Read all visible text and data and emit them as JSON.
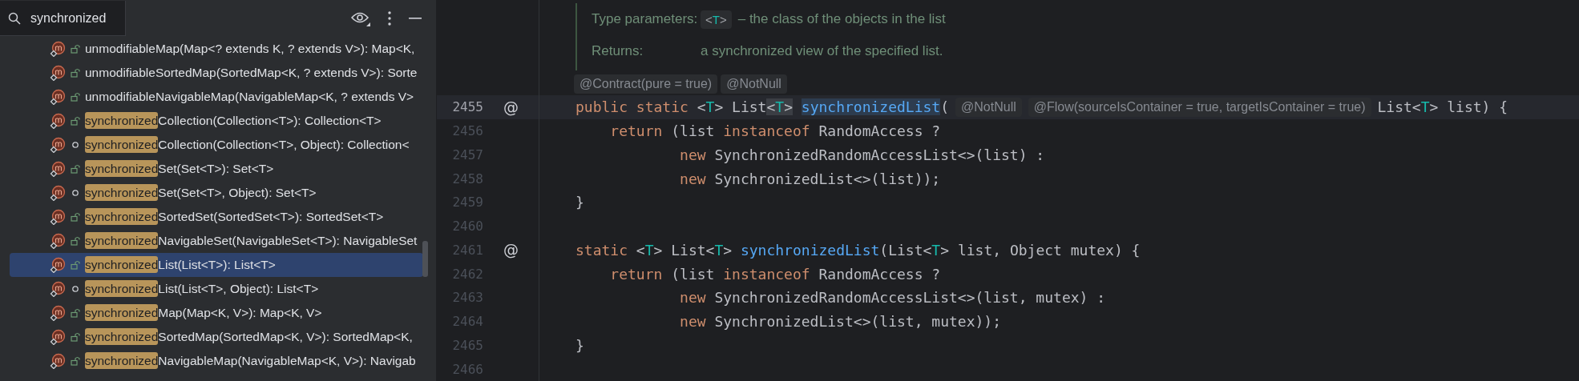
{
  "search": {
    "value": "synchronized"
  },
  "structure_items": [
    {
      "text": "unmodifiableMap(Map<? extends K, ? extends V>): Map<K,",
      "kind": "public",
      "selected": false
    },
    {
      "text": "unmodifiableSortedMap(SortedMap<K, ? extends V>): Sorte",
      "kind": "public",
      "selected": false
    },
    {
      "text": "unmodifiableNavigableMap(NavigableMap<K, ? extends V>",
      "kind": "public",
      "selected": false
    },
    {
      "match": "synchronized",
      "text": "Collection(Collection<T>): Collection<T>",
      "kind": "public",
      "selected": false
    },
    {
      "match": "synchronized",
      "text": "Collection(Collection<T>, Object): Collection<",
      "kind": "package",
      "selected": false
    },
    {
      "match": "synchronized",
      "text": "Set(Set<T>): Set<T>",
      "kind": "public",
      "selected": false
    },
    {
      "match": "synchronized",
      "text": "Set(Set<T>, Object): Set<T>",
      "kind": "package",
      "selected": false
    },
    {
      "match": "synchronized",
      "text": "SortedSet(SortedSet<T>): SortedSet<T>",
      "kind": "public",
      "selected": false
    },
    {
      "match": "synchronized",
      "text": "NavigableSet(NavigableSet<T>): NavigableSet",
      "kind": "public",
      "selected": false
    },
    {
      "match": "synchronized",
      "text": "List(List<T>): List<T>",
      "kind": "public",
      "selected": true
    },
    {
      "match": "synchronized",
      "text": "List(List<T>, Object): List<T>",
      "kind": "package",
      "selected": false
    },
    {
      "match": "synchronized",
      "text": "Map(Map<K, V>): Map<K, V>",
      "kind": "public",
      "selected": false
    },
    {
      "match": "synchronized",
      "text": "SortedMap(SortedMap<K, V>): SortedMap<K,",
      "kind": "public",
      "selected": false
    },
    {
      "match": "synchronized",
      "text": "NavigableMap(NavigableMap<K, V>): Navigab",
      "kind": "public",
      "selected": false
    }
  ],
  "editor": {
    "doc": [
      {
        "label": "Type parameters:",
        "chip": [
          {
            "text": "<",
            "kind": "plain"
          },
          {
            "text": "T",
            "kind": "type"
          },
          {
            "text": ">",
            "kind": "plain"
          }
        ],
        "text": "– the class of the objects in the list"
      },
      {
        "label": "Returns:",
        "text": "a synchronized view of the specified list."
      }
    ],
    "annotation_hints": [
      "@Contract(pure = true)",
      "@NotNull"
    ],
    "lines": [
      {
        "number": "2455",
        "current": true,
        "gutter_mark": "@",
        "segments": [
          {
            "text": "public static ",
            "kind": "keyword"
          },
          {
            "text": "<",
            "kind": "plain"
          },
          {
            "text": "T",
            "kind": "type"
          },
          {
            "text": "> List",
            "kind": "plain"
          },
          {
            "text": "<",
            "kind": "brace"
          },
          {
            "text": "T",
            "kind": "type-brace"
          },
          {
            "text": ">",
            "kind": "brace"
          },
          {
            "text": " synchronizedList",
            "kind": "usage"
          },
          {
            "text": "(",
            "kind": "plain"
          },
          {
            "text": "@NotNull",
            "kind": "hint"
          },
          {
            "text": "@Flow(sourceIsContainer = true, targetIsContainer = true)",
            "kind": "hint"
          },
          {
            "text": "List<",
            "kind": "plain"
          },
          {
            "text": "T",
            "kind": "type"
          },
          {
            "text": "> list) {",
            "kind": "plain"
          }
        ]
      },
      {
        "number": "2456",
        "current": false,
        "segments": [
          {
            "text": "    return",
            "kind": "keyword"
          },
          {
            "text": " (list ",
            "kind": "plain"
          },
          {
            "text": "instanceof",
            "kind": "keyword"
          },
          {
            "text": " RandomAccess ?",
            "kind": "plain"
          }
        ]
      },
      {
        "number": "2457",
        "current": false,
        "segments": [
          {
            "text": "            new",
            "kind": "keyword"
          },
          {
            "text": " SynchronizedRandomAccessList<>(list) :",
            "kind": "plain"
          }
        ]
      },
      {
        "number": "2458",
        "current": false,
        "segments": [
          {
            "text": "            new",
            "kind": "keyword"
          },
          {
            "text": " SynchronizedList<>(list));",
            "kind": "plain"
          }
        ]
      },
      {
        "number": "2459",
        "current": false,
        "segments": [
          {
            "text": "}",
            "kind": "plain"
          }
        ]
      },
      {
        "number": "2460",
        "current": false
      },
      {
        "number": "2461",
        "current": false,
        "gutter_mark": "@",
        "segments": [
          {
            "text": "static ",
            "kind": "keyword"
          },
          {
            "text": "<",
            "kind": "plain"
          },
          {
            "text": "T",
            "kind": "type"
          },
          {
            "text": "> List<",
            "kind": "plain"
          },
          {
            "text": "T",
            "kind": "type"
          },
          {
            "text": "> ",
            "kind": "plain"
          },
          {
            "text": "synchronizedList",
            "kind": "method"
          },
          {
            "text": "(List<",
            "kind": "plain"
          },
          {
            "text": "T",
            "kind": "type"
          },
          {
            "text": "> list, Object mutex) {",
            "kind": "plain"
          }
        ]
      },
      {
        "number": "2462",
        "current": false,
        "segments": [
          {
            "text": "    return",
            "kind": "keyword"
          },
          {
            "text": " (list ",
            "kind": "plain"
          },
          {
            "text": "instanceof",
            "kind": "keyword"
          },
          {
            "text": " RandomAccess ?",
            "kind": "plain"
          }
        ]
      },
      {
        "number": "2463",
        "current": false,
        "segments": [
          {
            "text": "            new",
            "kind": "keyword"
          },
          {
            "text": " SynchronizedRandomAccessList<>(list, mutex) :",
            "kind": "plain"
          }
        ]
      },
      {
        "number": "2464",
        "current": false,
        "segments": [
          {
            "text": "            new",
            "kind": "keyword"
          },
          {
            "text": " SynchronizedList<>(list, mutex));",
            "kind": "plain"
          }
        ]
      },
      {
        "number": "2465",
        "current": false,
        "segments": [
          {
            "text": "}",
            "kind": "plain"
          }
        ]
      },
      {
        "number": "2466",
        "current": false
      }
    ]
  }
}
